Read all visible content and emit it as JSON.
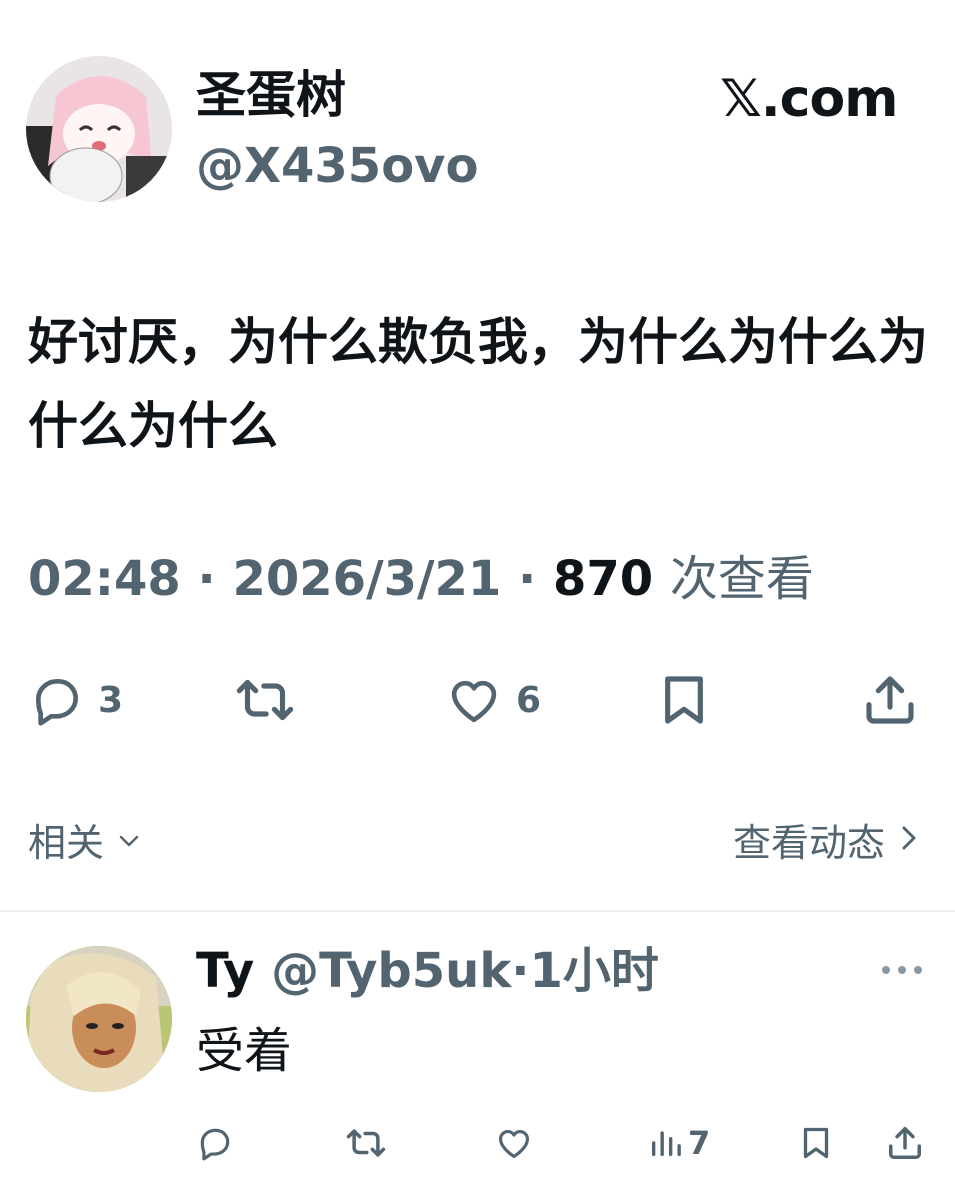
{
  "author": {
    "display_name": "圣蛋树",
    "handle": "@X435ovo",
    "avatar_icon": "anime-avatar"
  },
  "brand": "𝕏.com",
  "post": {
    "text": "好讨厌，为什么欺负我，为什么为什么为什么为什么",
    "time": "02:48",
    "date": "2026/3/21",
    "views_count": "870",
    "views_label": "次查看",
    "sep": "·"
  },
  "actions": {
    "reply_count": "3",
    "like_count": "6"
  },
  "related": {
    "label": "相关",
    "activity_label": "查看动态"
  },
  "reply": {
    "display_name": "Ty",
    "handle": "@Tyb5uk",
    "sep": "·",
    "time": "1小时",
    "text": "受着",
    "views_count": "7"
  },
  "colors": {
    "text": "#0f1419",
    "secondary": "#536471",
    "divider": "#eff3f4"
  }
}
